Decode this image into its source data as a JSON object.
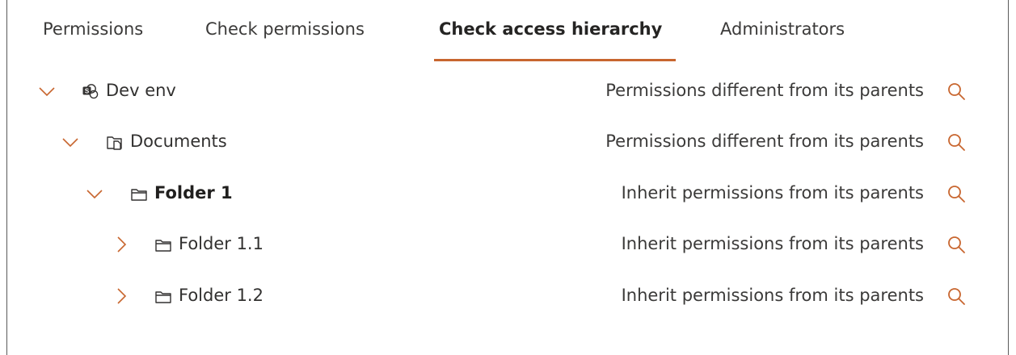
{
  "tabs": [
    {
      "label": "Permissions"
    },
    {
      "label": "Check permissions"
    },
    {
      "label": "Check access hierarchy",
      "active": true
    },
    {
      "label": "Administrators"
    }
  ],
  "tree": [
    {
      "label": "Dev env",
      "status": "Permissions different from its parents",
      "icon": "sharepoint-site-icon",
      "expanded": true,
      "level": 0
    },
    {
      "label": "Documents",
      "status": "Permissions different from its parents",
      "icon": "document-library-icon",
      "expanded": true,
      "level": 1
    },
    {
      "label": "Folder 1",
      "status": "Inherit permissions from its parents",
      "icon": "folder-icon",
      "expanded": true,
      "level": 2,
      "bold": true
    },
    {
      "label": "Folder 1.1",
      "status": "Inherit permissions from its parents",
      "icon": "folder-icon",
      "expanded": false,
      "level": 3
    },
    {
      "label": "Folder 1.2",
      "status": "Inherit permissions from its parents",
      "icon": "folder-icon",
      "expanded": false,
      "level": 3
    }
  ],
  "colors": {
    "accent": "#c8662f",
    "text": "#323130"
  }
}
